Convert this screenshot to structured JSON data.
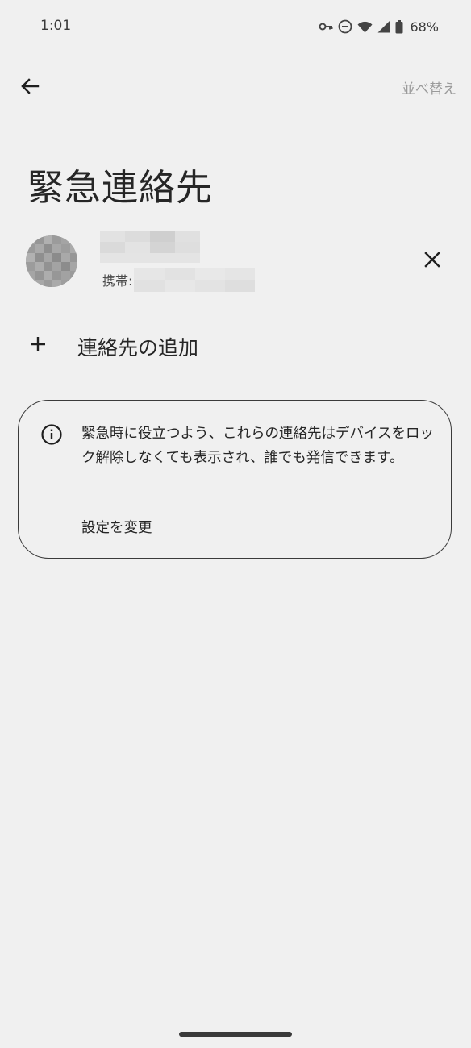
{
  "status_bar": {
    "time": "1:01",
    "battery_percent": "68%",
    "icons": [
      "vpn-key-icon",
      "do-not-disturb-icon",
      "wifi-icon",
      "cell-signal-icon",
      "battery-icon"
    ]
  },
  "app_bar": {
    "back_icon": "arrow-back-icon",
    "reorder_label": "並べ替え"
  },
  "page": {
    "title": "緊急連絡先"
  },
  "contact": {
    "phone_label": "携帯:",
    "remove_icon": "close-icon"
  },
  "add_contact": {
    "icon": "plus-icon",
    "label": "連絡先の追加"
  },
  "info_card": {
    "icon": "info-icon",
    "text": "緊急時に役立つよう、これらの連絡先はデバイスをロック解除しなくても表示され、誰でも発信できます。",
    "link_label": "設定を変更"
  },
  "colors": {
    "background": "#f0f0f0",
    "text": "#262626",
    "muted_action": "#9a9a9a",
    "card_border": "#3b3b3b"
  }
}
